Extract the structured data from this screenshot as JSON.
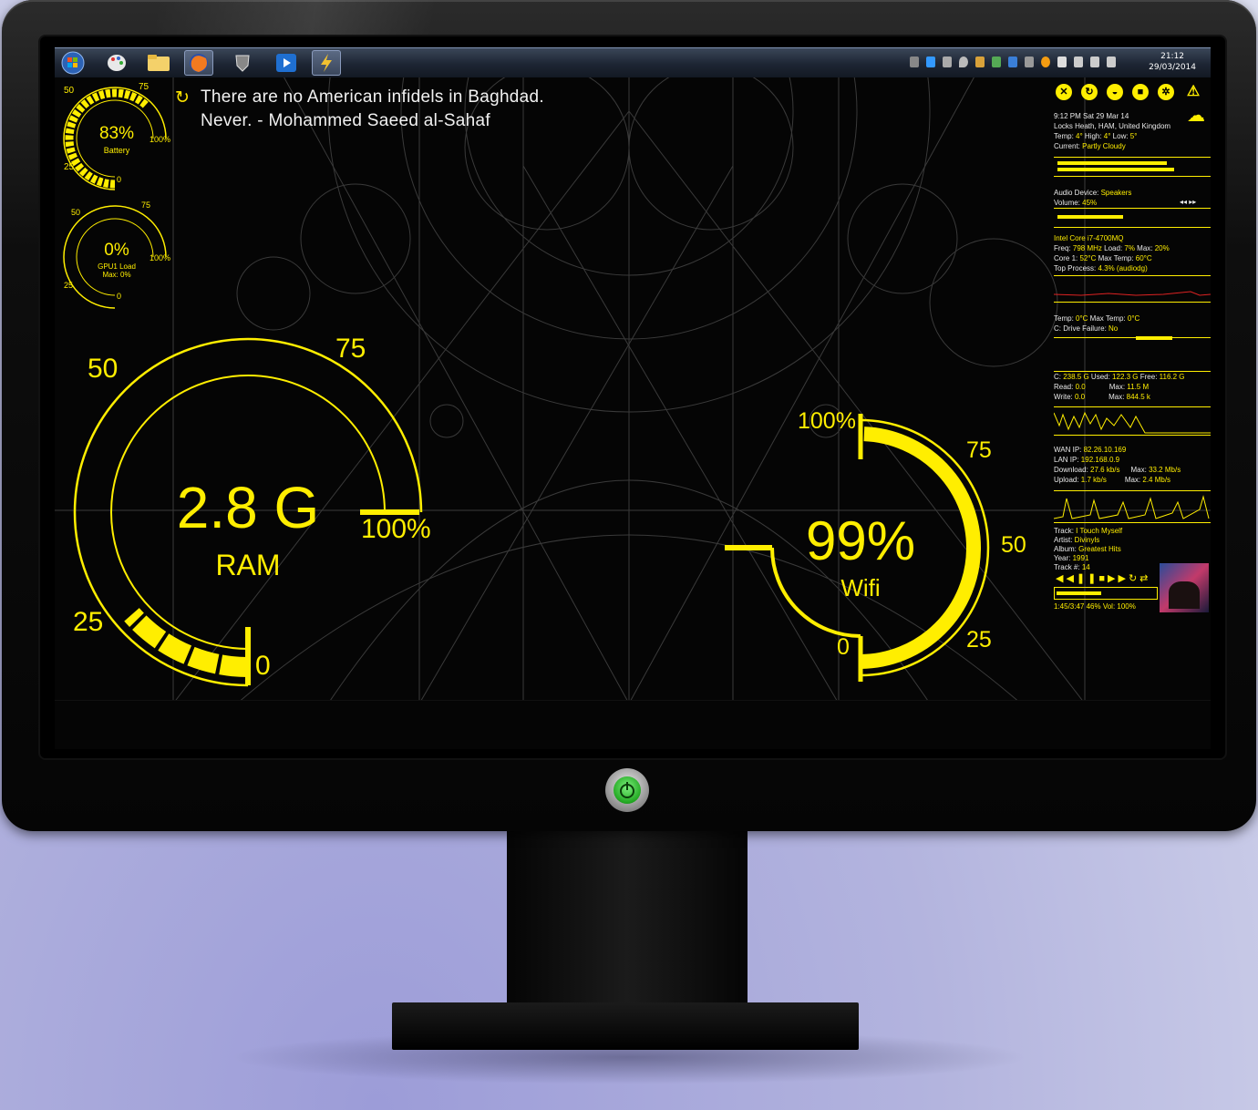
{
  "taskbar": {
    "apps": [
      "start-orb",
      "paint-app",
      "file-explorer",
      "firefox",
      "world-of-tanks",
      "media-player",
      "rainmeter"
    ],
    "clock_time": "21:12",
    "clock_date": "29/03/2014"
  },
  "quote": {
    "line1": "There are no American infidels in Baghdad.",
    "line2": "Never. - Mohammed Saeed al-Sahaf"
  },
  "battery_gauge": {
    "value_label": "83%",
    "caption": "Battery",
    "value": 0.83,
    "tick_50": "50",
    "tick_75": "75",
    "tick_25": "25",
    "tick_100": "100%",
    "tick_0": "0"
  },
  "gpu_gauge": {
    "value_label": "0%",
    "caption1": "GPU1 Load",
    "caption2": "Max: 0%",
    "value": 0,
    "tick_50": "50",
    "tick_75": "75",
    "tick_25": "25",
    "tick_100": "100%",
    "tick_0": "0"
  },
  "ram_gauge": {
    "value_label": "2.8 G",
    "caption": "RAM",
    "fill_fraction": 0.18,
    "tick_50": "50",
    "tick_75": "75",
    "tick_25": "25",
    "tick_100": "100%",
    "tick_0": "0"
  },
  "wifi_gauge": {
    "value_label": "99%",
    "caption": "Wifi",
    "value": 0.99,
    "tick_100": "100%",
    "tick_75": "75",
    "tick_50": "50",
    "tick_25": "25",
    "tick_0": "0"
  },
  "panel": {
    "weather": {
      "line1": "9:12 PM Sat 29 Mar 14",
      "line2": "Locks Heath, HAM, United Kingdom",
      "temp_label": "Temp: ",
      "temp": "4°",
      "high_label": " High: ",
      "high": "4°",
      "low_label": " Low: ",
      "low": "5°",
      "current_label": "Current: ",
      "current": "Partly Cloudy"
    },
    "audio": {
      "device_label": "Audio Device: ",
      "device": "Speakers",
      "volume_label": "Volume: ",
      "volume": "45%",
      "volume_value": 0.45
    },
    "cpu": {
      "name": "Intel Core i7-4700MQ",
      "freq_label": "Freq: ",
      "freq": "798 MHz",
      "load_label": " Load: ",
      "load": "7%",
      "max_label": " Max: ",
      "max": "20%",
      "core_label": "Core 1: ",
      "core": "52°C",
      "maxtemp_label": " Max Temp: ",
      "maxtemp": "60°C",
      "top_label": "Top Process: ",
      "top": "4.3% (audiodg)"
    },
    "drive_temp": {
      "temp_label": "Temp: ",
      "temp": "0°C",
      "max_label": " Max Temp: ",
      "max": "0°C",
      "failure_label": "C: Drive Failure: ",
      "failure": "No"
    },
    "disk": {
      "line1_label": "C: ",
      "size": "238.5 G",
      "used_label": " Used: ",
      "used": "122.3 G",
      "free_label": " Free: ",
      "free": "116.2 G",
      "read_label": "Read: ",
      "read": "0.0",
      "read_max_label": "Max: ",
      "read_max": "11.5 M",
      "write_label": "Write: ",
      "write": "0.0",
      "write_max_label": "Max: ",
      "write_max": "844.5 k"
    },
    "network": {
      "wan_label": "WAN IP: ",
      "wan": "82.26.10.169",
      "lan_label": "LAN IP: ",
      "lan": "192.168.0.9",
      "down_label": "Download: ",
      "down": "27.6 kb/s",
      "down_max_label": "Max: ",
      "down_max": "33.2 Mb/s",
      "up_label": "Upload: ",
      "up": "1.7 kb/s",
      "up_max_label": "Max: ",
      "up_max": "2.4 Mb/s"
    },
    "music": {
      "track_label": "Track: ",
      "track": "I Touch Myself",
      "artist_label": "Artist: ",
      "artist": "Divinyls",
      "album_label": "Album: ",
      "album": "Greatest Hits",
      "year_label": "Year: ",
      "year": "1991",
      "number_label": "Track #: ",
      "number": "14",
      "status": "1:45/3:47  46%  Vol: 100%",
      "progress": 0.46
    }
  },
  "colors": {
    "accent": "#ffee00",
    "screen_bg": "#050505",
    "wallpaper_bg": "#b3b4de"
  }
}
